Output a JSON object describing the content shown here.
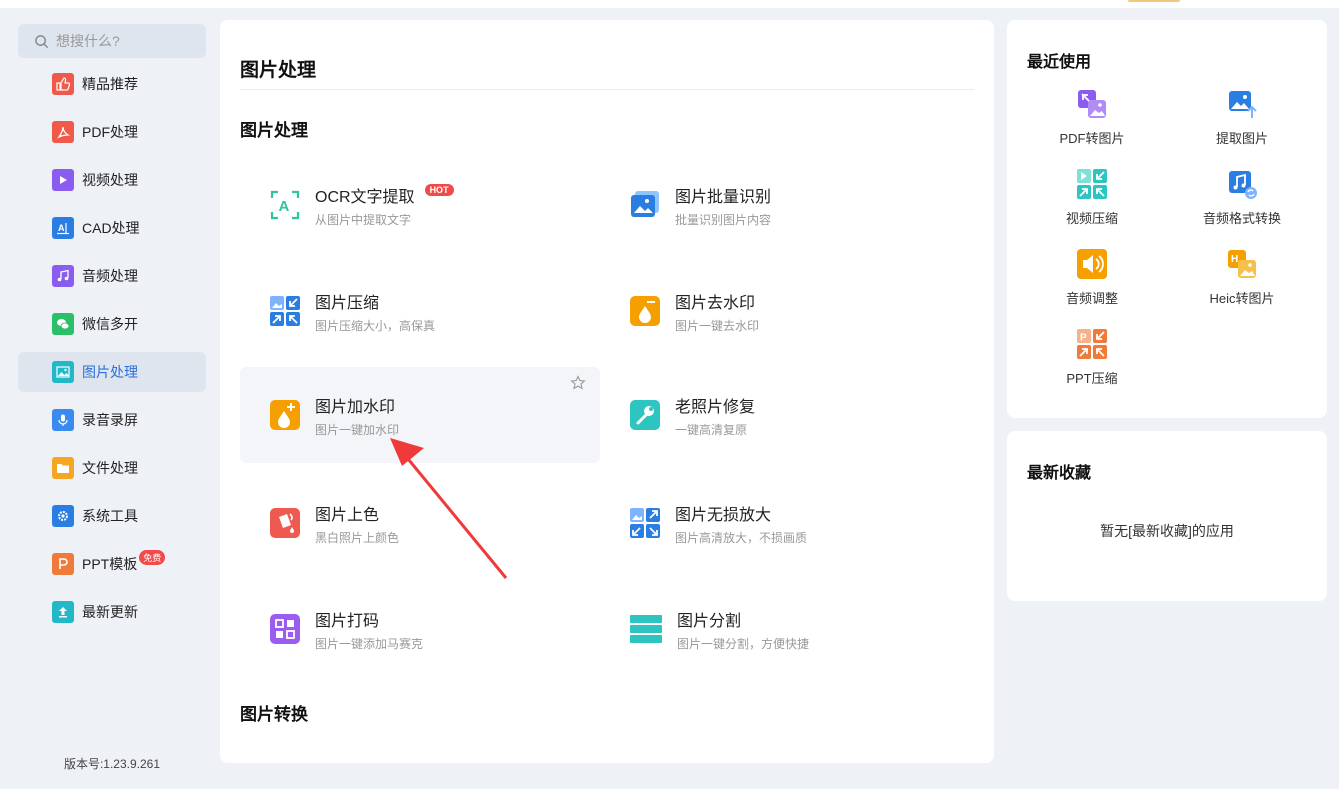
{
  "search": {
    "placeholder": "想搜什么?"
  },
  "sidebar": {
    "items": [
      {
        "label": "精品推荐",
        "icon": "thumbs-up-icon",
        "color": "#f05a4a"
      },
      {
        "label": "PDF处理",
        "icon": "pdf-icon",
        "color": "#f05a4a"
      },
      {
        "label": "视频处理",
        "icon": "play-icon",
        "color": "#8a5cf0"
      },
      {
        "label": "CAD处理",
        "icon": "cad-icon",
        "color": "#2a7de1"
      },
      {
        "label": "音频处理",
        "icon": "music-icon",
        "color": "#8a5cf0"
      },
      {
        "label": "微信多开",
        "icon": "wechat-icon",
        "color": "#2bbf6a"
      },
      {
        "label": "图片处理",
        "icon": "image-icon",
        "color": "#22b8c8",
        "active": true
      },
      {
        "label": "录音录屏",
        "icon": "mic-icon",
        "color": "#3a8af0"
      },
      {
        "label": "文件处理",
        "icon": "folder-icon",
        "color": "#f5a623"
      },
      {
        "label": "系统工具",
        "icon": "gear-icon",
        "color": "#2a7de1"
      },
      {
        "label": "PPT模板",
        "icon": "ppt-icon",
        "color": "#f07a3a",
        "badge": "免费"
      },
      {
        "label": "最新更新",
        "icon": "upload-icon",
        "color": "#22b8c8"
      }
    ]
  },
  "version": "版本号:1.23.9.261",
  "main": {
    "title": "图片处理",
    "section1": "图片处理",
    "section2": "图片转换",
    "tiles": [
      {
        "name": "OCR文字提取",
        "desc": "从图片中提取文字",
        "badge": "HOT",
        "icon": "ocr-icon"
      },
      {
        "name": "图片批量识别",
        "desc": "批量识别图片内容",
        "icon": "batch-image-icon"
      },
      {
        "name": "图片压缩",
        "desc": "图片压缩大小，高保真",
        "icon": "compress-icon"
      },
      {
        "name": "图片去水印",
        "desc": "图片一键去水印",
        "icon": "remove-watermark-icon"
      },
      {
        "name": "图片加水印",
        "desc": "图片一键加水印",
        "icon": "add-watermark-icon"
      },
      {
        "name": "老照片修复",
        "desc": "一键高清复原",
        "icon": "photo-repair-icon"
      },
      {
        "name": "图片上色",
        "desc": "黑白照片上颜色",
        "icon": "colorize-icon"
      },
      {
        "name": "图片无损放大",
        "desc": "图片高清放大，不损画质",
        "icon": "upscale-icon"
      },
      {
        "name": "图片打码",
        "desc": "图片一键添加马赛克",
        "icon": "mosaic-icon"
      },
      {
        "name": "图片分割",
        "desc": "图片一键分割，方便快捷",
        "icon": "split-icon"
      }
    ]
  },
  "recent": {
    "title": "最近使用",
    "items": [
      {
        "label": "PDF转图片",
        "icon": "pdf-to-image-icon"
      },
      {
        "label": "提取图片",
        "icon": "extract-image-icon"
      },
      {
        "label": "视频压缩",
        "icon": "video-compress-icon"
      },
      {
        "label": "音频格式转换",
        "icon": "audio-convert-icon"
      },
      {
        "label": "音频调整",
        "icon": "audio-adjust-icon"
      },
      {
        "label": "Heic转图片",
        "icon": "heic-icon"
      },
      {
        "label": "PPT压缩",
        "icon": "ppt-compress-icon"
      }
    ]
  },
  "favorites": {
    "title": "最新收藏",
    "empty": "暂无[最新收藏]的应用"
  }
}
